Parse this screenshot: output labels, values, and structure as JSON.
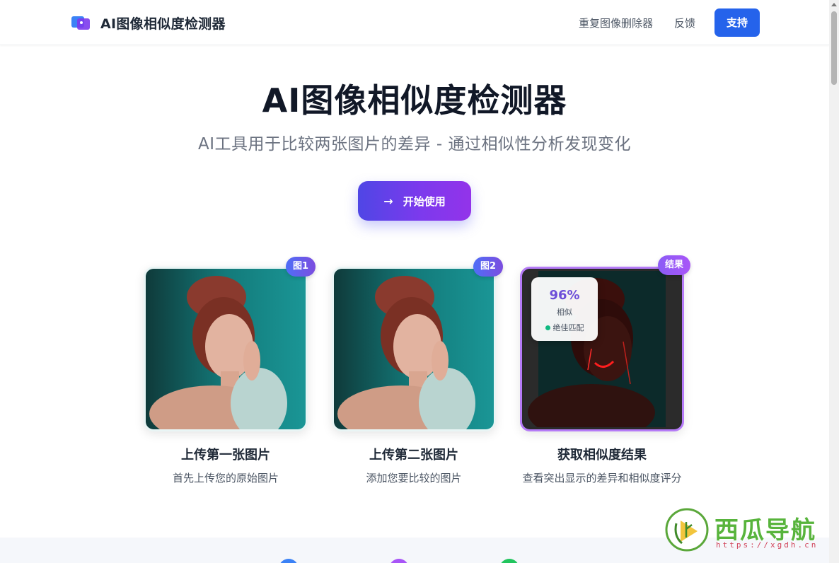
{
  "header": {
    "brand": "AI图像相似度检测器",
    "nav": {
      "duplicate_remover": "重复图像删除器",
      "feedback": "反馈",
      "support": "支持"
    }
  },
  "hero": {
    "title": "AI图像相似度检测器",
    "subtitle": "AI工具用于比较两张图片的差异 - 通过相似性分析发现变化",
    "cta": "开始使用"
  },
  "steps": [
    {
      "badge": "图1",
      "title": "上传第一张图片",
      "description": "首先上传您的原始图片"
    },
    {
      "badge": "图2",
      "title": "上传第二张图片",
      "description": "添加您要比较的图片"
    },
    {
      "badge": "结果",
      "title": "获取相似度结果",
      "description": "查看突出显示的差异和相似度评分"
    }
  ],
  "result": {
    "score": "96%",
    "label": "相似",
    "status": "绝佳匹配",
    "status_color": "#10b981"
  },
  "colors": {
    "primary": "#2563eb",
    "gradient_start": "#4f46e5",
    "gradient_end": "#9333ea",
    "result_border": "#b57bf7"
  },
  "watermark": {
    "text": "西瓜导航",
    "url": "https://xgdh.cn"
  }
}
